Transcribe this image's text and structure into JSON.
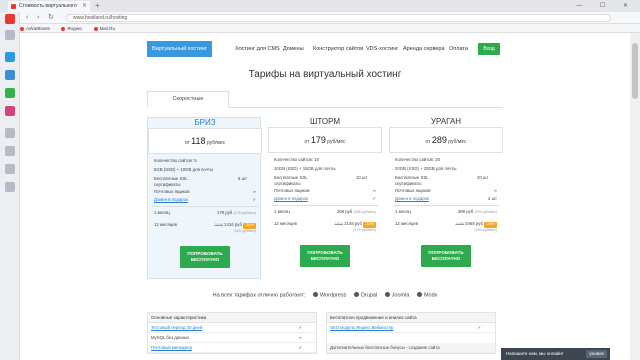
{
  "browser": {
    "tab_title": "Стоимость виртуального",
    "url": "www.hostland.ru/hosting",
    "bookmarks": [
      "AdvatBinets",
      "Яндекс",
      "Mail.Ru"
    ],
    "window_controls": "— ☐ ✕"
  },
  "nav": {
    "items": [
      "Виртуальный хостинг",
      "Хостинг для CMS",
      "Домены",
      "Конструктор сайтов",
      "VDS-хостинг",
      "Аренда сервера",
      "Оплата"
    ],
    "login": "Вход"
  },
  "page": {
    "title": "Тарифы на виртуальный хостинг",
    "tab_fast": "Скоростные"
  },
  "plans": [
    {
      "name": "БРИЗ",
      "price_prefix": "от",
      "price": "118",
      "price_unit": "руб/мес",
      "sites_label": "Количество сайтов:",
      "sites": "5",
      "disk": "5GB (SSD) + 10GB для почты",
      "ssl_label": "Бесплатные SSL сертификаты",
      "ssl_value": "5 шт",
      "mailboxes": "Почтовых ящиков",
      "domain_gift": "Домен в подарок",
      "domain_value": "✓",
      "m1_label": "1 месяц",
      "m1_price": "178 руб",
      "m1_note": "(178 руб/мес)",
      "m12_label": "12 месяцев",
      "m12_old": "2136",
      "m12_price": "1416 руб",
      "m12_discount": "-34%",
      "m12_note": "(118 руб/мес)",
      "cta": "ПОПРОБОВАТЬ БЕСПЛАТНО"
    },
    {
      "name": "ШТОРМ",
      "price_prefix": "от",
      "price": "179",
      "price_unit": "руб/мес",
      "sites_label": "Количество сайтов:",
      "sites": "10",
      "disk": "10GB (SSD) + 15GB для почты",
      "ssl_label": "Бесплатные SSL сертификаты",
      "ssl_value": "10 шт",
      "mailboxes": "Почтовых ящиков",
      "domain_gift": "Домен в подарок",
      "domain_value": "✓",
      "m1_label": "1 месяц",
      "m1_price": "268 руб",
      "m1_note": "(268 руб/мес)",
      "m12_label": "12 месяцев",
      "m12_old": "3216",
      "m12_price": "2148 руб",
      "m12_discount": "-33%",
      "m12_note": "(179 руб/мес)",
      "cta": "ПОПРОБОВАТЬ БЕСПЛАТНО"
    },
    {
      "name": "УРАГАН",
      "price_prefix": "от",
      "price": "289",
      "price_unit": "руб/мес",
      "sites_label": "Количество сайтов:",
      "sites": "20",
      "disk": "20GB (SSD) + 20GB для почты",
      "ssl_label": "Бесплатные SSL сертификаты",
      "ssl_value": "20 шт",
      "mailboxes": "Почтовых ящиков",
      "domain_gift": "Домен в подарок",
      "domain_value": "2 шт",
      "m1_label": "1 месяц",
      "m1_price": "399 руб",
      "m1_note": "(399 руб/мес)",
      "m12_label": "12 месяцев",
      "m12_old": "4788",
      "m12_price": "3468 руб",
      "m12_discount": "-28%",
      "m12_note": "(289 руб/мес)",
      "cta": "ПОПРОБОВАТЬ БЕСПЛАТНО"
    }
  ],
  "cms_line": {
    "text": "На всех тарифах отлично работают:",
    "items": [
      "Wordpress",
      "Drupal",
      "Joomla",
      "Modx"
    ]
  },
  "features_left": {
    "header": "Основные характеристики",
    "rows": [
      "Тестовый период 30 дней",
      "MySQL без данных",
      "Почтовый менеджер"
    ]
  },
  "features_right": {
    "header": "Бесплатное продвижение и анализ сайта",
    "rows": [
      "SEO модуль Яндекс.Вебмастер",
      "Дополнительные бесплатные бонусы - создание сайта"
    ]
  },
  "chat": {
    "text": "Напишите нам, мы онлайн!",
    "button": "уновое"
  },
  "colors": {
    "accent_blue": "#3c98dd",
    "cta_green": "#2eaa4e",
    "discount_orange": "#f5a623"
  }
}
